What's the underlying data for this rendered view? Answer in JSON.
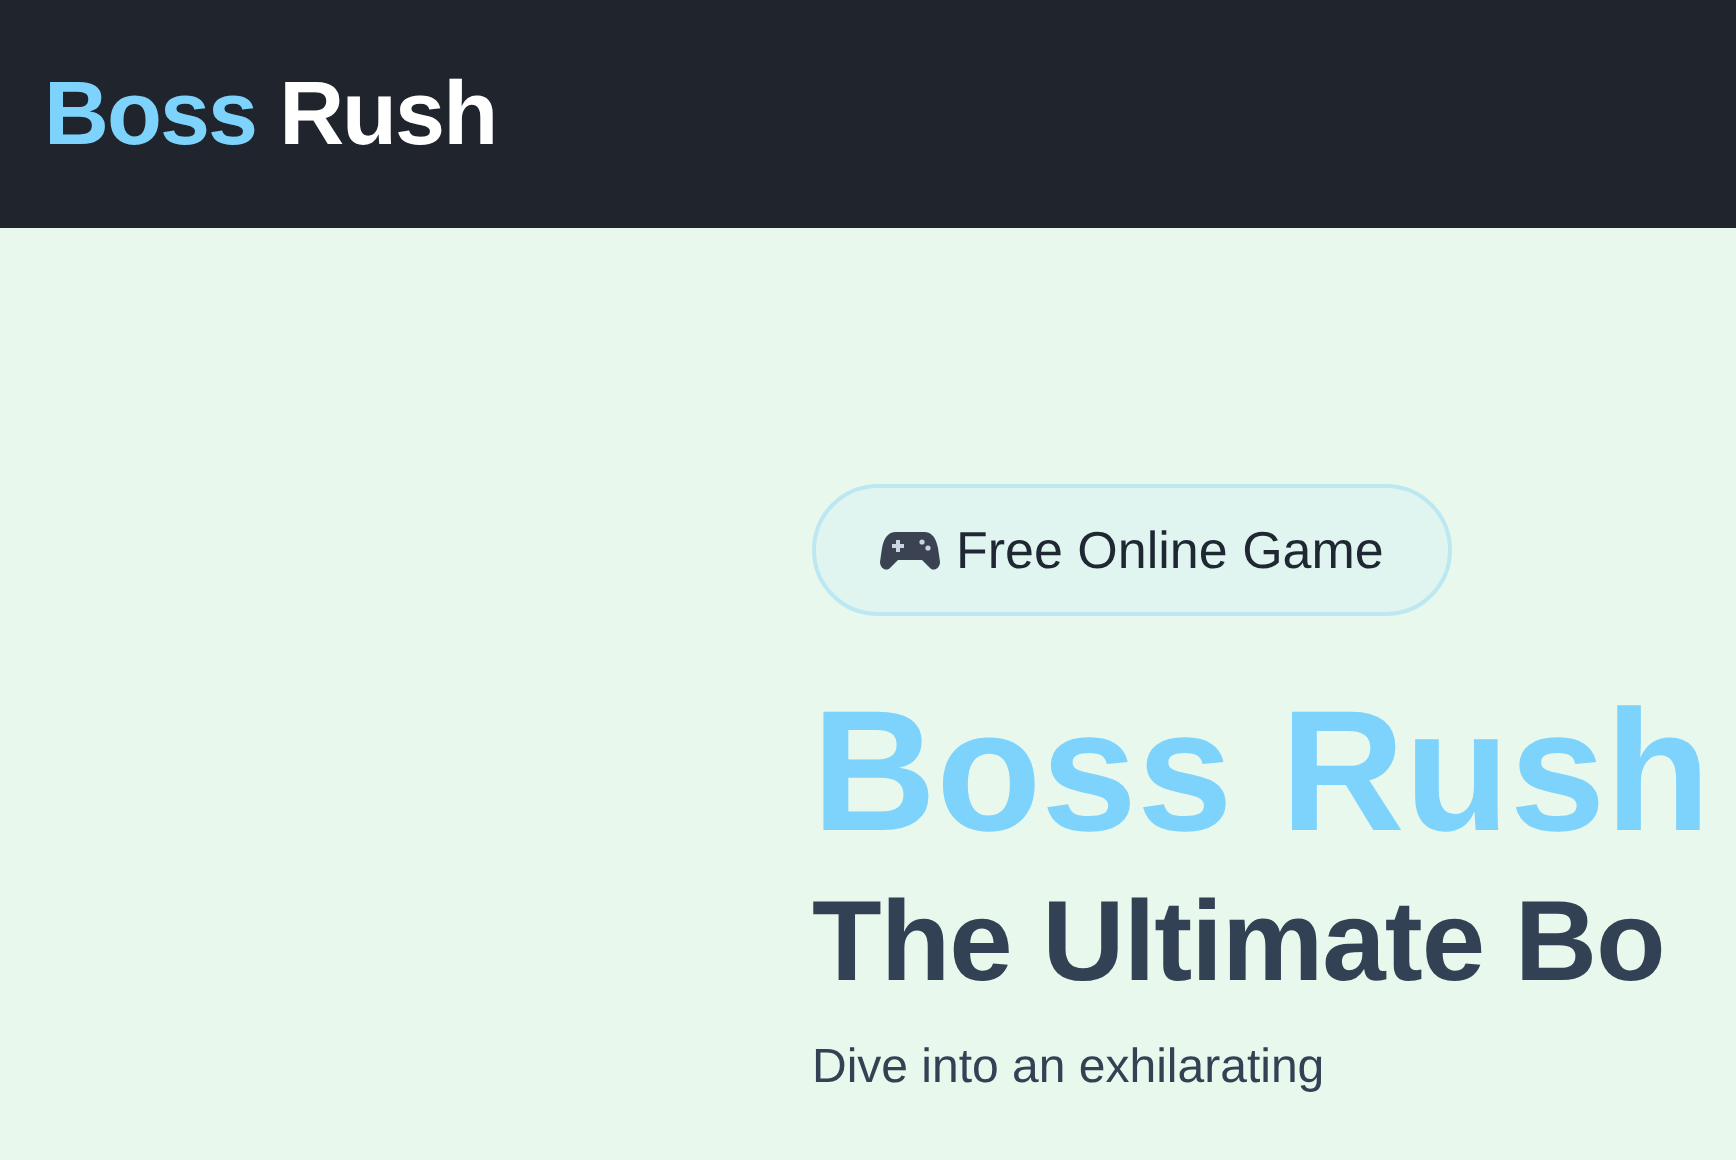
{
  "header": {
    "logo": {
      "first": "Boss",
      "second": "Rush"
    }
  },
  "hero": {
    "badge": "Free Online Game",
    "title": "Boss Rush",
    "subtitle": "The Ultimate Bo",
    "intro": "Dive into an exhilarating"
  }
}
